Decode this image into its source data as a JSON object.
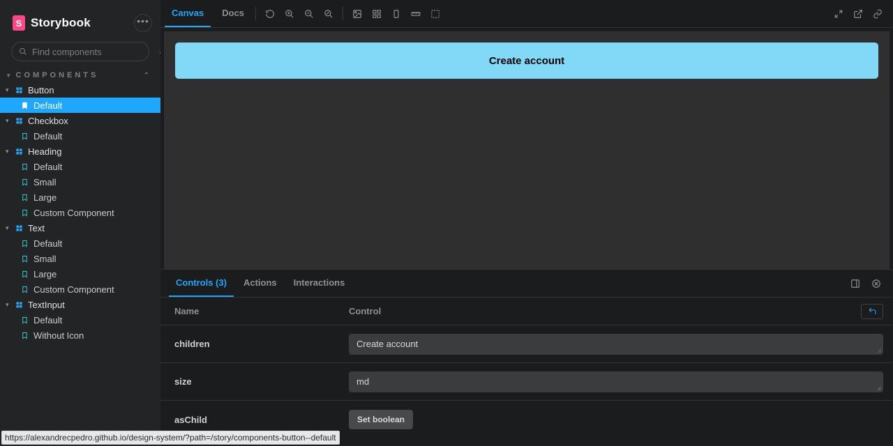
{
  "app": {
    "name": "Storybook"
  },
  "search": {
    "placeholder": "Find components",
    "shortcut": "/"
  },
  "sections": {
    "components": "COMPONENTS"
  },
  "tree": {
    "button": {
      "label": "Button",
      "stories": {
        "default": "Default"
      }
    },
    "checkbox": {
      "label": "Checkbox",
      "stories": {
        "default": "Default"
      }
    },
    "heading": {
      "label": "Heading",
      "stories": {
        "default": "Default",
        "small": "Small",
        "large": "Large",
        "custom": "Custom Component"
      }
    },
    "text": {
      "label": "Text",
      "stories": {
        "default": "Default",
        "small": "Small",
        "large": "Large",
        "custom": "Custom Component"
      }
    },
    "textinput": {
      "label": "TextInput",
      "stories": {
        "default": "Default",
        "without_icon": "Without Icon"
      }
    }
  },
  "toolbar": {
    "canvas": "Canvas",
    "docs": "Docs"
  },
  "preview": {
    "button_label": "Create account"
  },
  "addons": {
    "controls": "Controls (3)",
    "actions": "Actions",
    "interactions": "Interactions",
    "header_name": "Name",
    "header_control": "Control",
    "rows": {
      "children": {
        "name": "children",
        "value": "Create account"
      },
      "size": {
        "name": "size",
        "value": "md"
      },
      "asChild": {
        "name": "asChild",
        "button": "Set boolean"
      }
    }
  },
  "status_url": "https://alexandrecpedro.github.io/design-system/?path=/story/components-button--default"
}
